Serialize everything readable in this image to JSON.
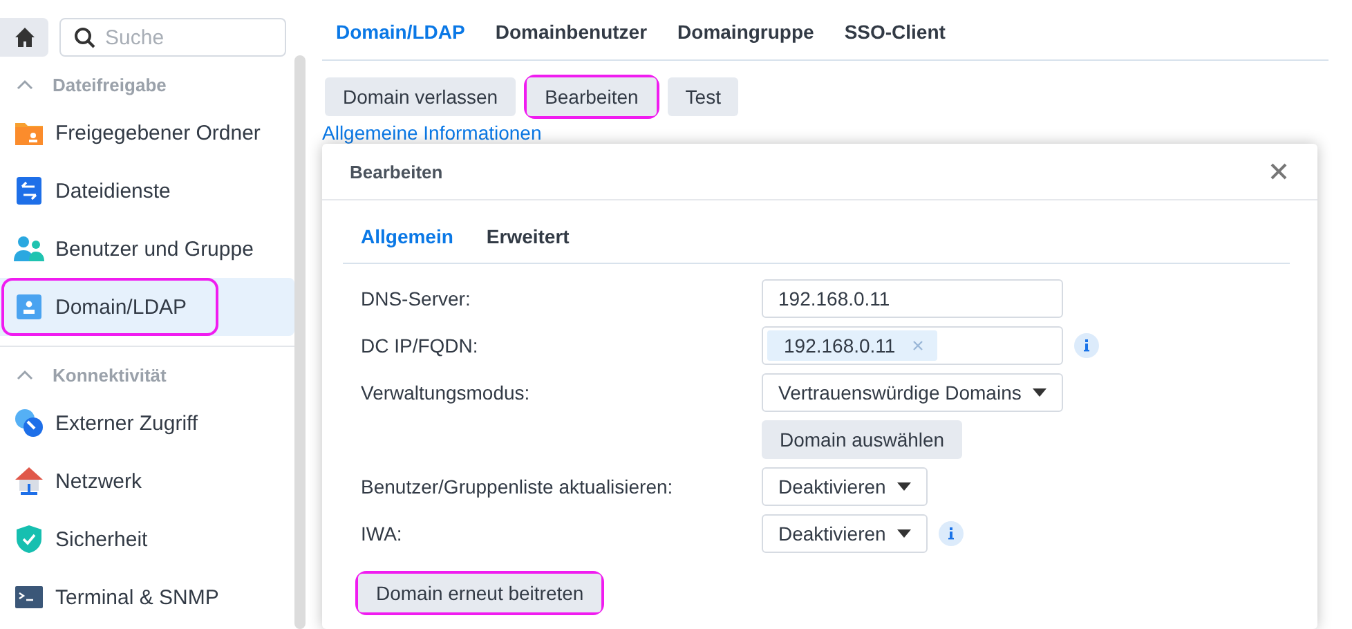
{
  "sidebar": {
    "search": {
      "placeholder": "Suche"
    },
    "sections": [
      {
        "title": "Dateifreigabe",
        "expanded": true,
        "items": [
          {
            "label": "Freigegebener Ordner",
            "selected": false,
            "highlighted": false
          },
          {
            "label": "Dateidienste",
            "selected": false,
            "highlighted": false
          },
          {
            "label": "Benutzer und Gruppe",
            "selected": false,
            "highlighted": false
          },
          {
            "label": "Domain/LDAP",
            "selected": true,
            "highlighted": true
          }
        ]
      },
      {
        "title": "Konnektivität",
        "expanded": true,
        "items": [
          {
            "label": "Externer Zugriff",
            "selected": false,
            "highlighted": false
          },
          {
            "label": "Netzwerk",
            "selected": false,
            "highlighted": false
          },
          {
            "label": "Sicherheit",
            "selected": false,
            "highlighted": false
          },
          {
            "label": "Terminal & SNMP",
            "selected": false,
            "highlighted": false
          }
        ]
      }
    ]
  },
  "tabs": [
    {
      "label": "Domain/LDAP",
      "selected": true
    },
    {
      "label": "Domainbenutzer",
      "selected": false
    },
    {
      "label": "Domaingruppe",
      "selected": false
    },
    {
      "label": "SSO-Client",
      "selected": false
    }
  ],
  "toolbar": [
    {
      "label": "Domain verlassen",
      "highlighted": false
    },
    {
      "label": "Bearbeiten",
      "highlighted": true
    },
    {
      "label": "Test",
      "highlighted": false
    }
  ],
  "section_link": "Allgemeine Informationen",
  "dialog": {
    "title": "Bearbeiten",
    "tabs": [
      {
        "label": "Allgemein",
        "selected": true
      },
      {
        "label": "Erweitert",
        "selected": false
      }
    ],
    "rows": [
      {
        "kind": "text",
        "label": "DNS-Server:",
        "value": "192.168.0.11"
      },
      {
        "kind": "tags",
        "label": "DC IP/FQDN:",
        "tags": [
          "192.168.0.11"
        ],
        "info": true
      },
      {
        "kind": "wide-select",
        "label": "Verwaltungsmodus:",
        "value": "Vertrauenswürdige Domains"
      },
      {
        "kind": "button",
        "label": "Domain auswählen"
      },
      {
        "kind": "select",
        "label": "Benutzer/Gruppenliste aktualisieren:",
        "value": "Deaktivieren"
      },
      {
        "kind": "select",
        "label": "IWA:",
        "value": "Deaktivieren",
        "info": true
      }
    ],
    "action": {
      "label": "Domain erneut beitreten",
      "highlighted": true
    }
  }
}
